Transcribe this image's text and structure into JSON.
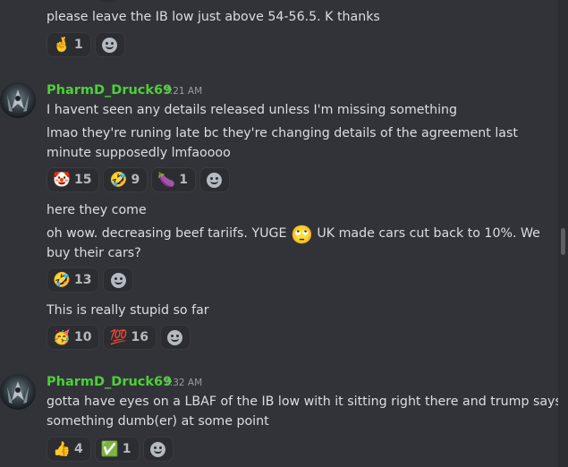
{
  "messages": {
    "m0": {
      "text": "please leave the IB low just above 54-56.5. K thanks"
    },
    "m0_reactions": [
      {
        "emoji": "🤞",
        "count": "1"
      }
    ],
    "group1": {
      "author": "PharmD_Druck69",
      "timestamp": "7:21 AM",
      "lines": [
        "I havent seen any details released unless I'm missing something",
        "lmao they're runing late bc they're changing details of the agreement last",
        "minute supposedly lmfaoooo"
      ],
      "reactions": [
        {
          "emoji": "🤡",
          "count": "15"
        },
        {
          "emoji": "🤣",
          "count": "9"
        },
        {
          "emoji": "🍆",
          "count": "1"
        }
      ],
      "line_here": "here they come",
      "line_beef_a": "oh wow. decreasing beef tariifs. YUGE",
      "line_beef_emoji": "🙄",
      "line_beef_b": "UK made cars cut back to 10%. We",
      "line_beef_c": "buy their cars?",
      "beef_reactions": [
        {
          "emoji": "🤣",
          "count": "13"
        }
      ],
      "line_stupid": "This is really stupid so far",
      "stupid_reactions": [
        {
          "emoji": "🥳",
          "count": "10"
        },
        {
          "emoji": "💯",
          "count": "16"
        }
      ]
    },
    "group2": {
      "author": "PharmD_Druck69",
      "timestamp": "7:32 AM",
      "lines": [
        "gotta have eyes on a LBAF of the IB low with it sitting right there and trump says",
        "something dumb(er) at some point"
      ],
      "reactions": [
        {
          "emoji": "👍",
          "count": "4"
        },
        {
          "emoji": "✅",
          "count": "1"
        }
      ]
    }
  },
  "icons": {
    "add_reaction": "add-reaction-smiley-icon",
    "avatar": "skull-avatar"
  },
  "colors": {
    "background": "#323339",
    "author": "#4cd137",
    "text": "#dbdee1",
    "timestamp": "#949ba4"
  }
}
